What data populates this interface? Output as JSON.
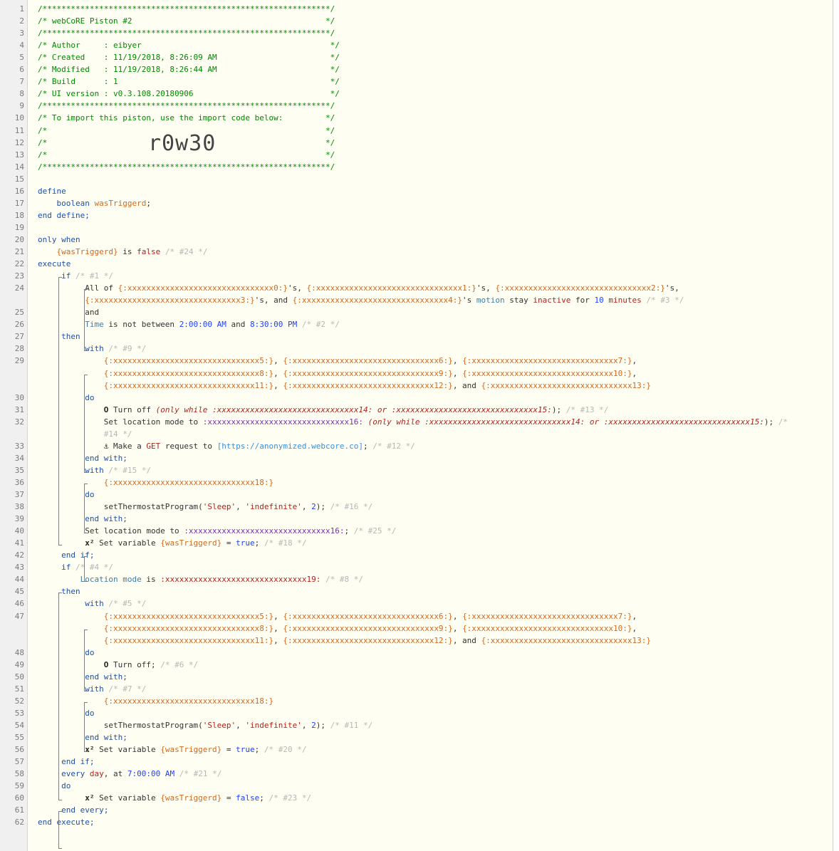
{
  "import_code": "r0w30",
  "lines": [
    {
      "n": "1",
      "parts": [
        {
          "t": "/*************************************************************/",
          "c": "c"
        }
      ]
    },
    {
      "n": "2",
      "parts": [
        {
          "t": "/* webCoRE Piston #2                                         */",
          "c": "c"
        }
      ]
    },
    {
      "n": "3",
      "parts": [
        {
          "t": "/*************************************************************/",
          "c": "c"
        }
      ]
    },
    {
      "n": "4",
      "parts": [
        {
          "t": "/* Author     : eibyer                                        */",
          "c": "c"
        }
      ]
    },
    {
      "n": "5",
      "parts": [
        {
          "t": "/* Created    : 11/19/2018, 8:26:09 AM                        */",
          "c": "c"
        }
      ]
    },
    {
      "n": "6",
      "parts": [
        {
          "t": "/* Modified   : 11/19/2018, 8:26:44 AM                        */",
          "c": "c"
        }
      ]
    },
    {
      "n": "7",
      "parts": [
        {
          "t": "/* Build      : 1                                             */",
          "c": "c"
        }
      ]
    },
    {
      "n": "8",
      "parts": [
        {
          "t": "/* UI version : v0.3.108.20180906                             */",
          "c": "c"
        }
      ]
    },
    {
      "n": "9",
      "parts": [
        {
          "t": "/*************************************************************/",
          "c": "c"
        }
      ]
    },
    {
      "n": "10",
      "parts": [
        {
          "t": "/* To import this piston, use the import code below:         */",
          "c": "c"
        }
      ]
    },
    {
      "n": "11",
      "parts": [
        {
          "t": "/*                                                           */",
          "c": "c"
        }
      ]
    },
    {
      "n": "12",
      "parts": [
        {
          "t": "/*                                                           */",
          "c": "c"
        }
      ]
    },
    {
      "n": "13",
      "parts": [
        {
          "t": "/*                                                           */",
          "c": "c"
        }
      ]
    },
    {
      "n": "14",
      "parts": [
        {
          "t": "/*************************************************************/",
          "c": "c"
        }
      ]
    },
    {
      "n": "15",
      "parts": []
    },
    {
      "n": "16",
      "parts": [
        {
          "t": "define",
          "c": "kw"
        }
      ]
    },
    {
      "n": "17",
      "parts": [
        {
          "t": "    boolean ",
          "c": "kw"
        },
        {
          "t": "wasTriggerd",
          "c": "var"
        },
        {
          "t": ";",
          "c": ""
        }
      ]
    },
    {
      "n": "18",
      "parts": [
        {
          "t": "end define;",
          "c": "kw"
        }
      ]
    },
    {
      "n": "19",
      "parts": []
    },
    {
      "n": "20",
      "parts": [
        {
          "t": "only when",
          "c": "kw"
        }
      ]
    },
    {
      "n": "21",
      "parts": [
        {
          "t": "    {wasTriggerd}",
          "c": "var"
        },
        {
          "t": " is ",
          "c": ""
        },
        {
          "t": "false",
          "c": "st"
        },
        {
          "t": " /* #24 */",
          "c": "cmt"
        }
      ]
    },
    {
      "n": "22",
      "parts": [
        {
          "t": "execute",
          "c": "kw"
        }
      ]
    },
    {
      "n": "23",
      "parts": [
        {
          "t": "     if",
          "c": "kw"
        },
        {
          "t": " /* #1 */",
          "c": "cmt"
        }
      ]
    },
    {
      "n": "24",
      "parts": [
        {
          "t": "          All of ",
          "c": ""
        },
        {
          "t": "{:xxxxxxxxxxxxxxxxxxxxxxxxxxxxxxx0:}",
          "c": "dev"
        },
        {
          "t": "'s, ",
          "c": ""
        },
        {
          "t": "{:xxxxxxxxxxxxxxxxxxxxxxxxxxxxxxx1:}",
          "c": "dev"
        },
        {
          "t": "'s, ",
          "c": ""
        },
        {
          "t": "{:xxxxxxxxxxxxxxxxxxxxxxxxxxxxxxx2:}",
          "c": "dev"
        },
        {
          "t": "'s,",
          "c": ""
        }
      ]
    },
    {
      "n": "",
      "parts": [
        {
          "t": "          {:xxxxxxxxxxxxxxxxxxxxxxxxxxxxxxx3:}",
          "c": "dev"
        },
        {
          "t": "'s, and ",
          "c": ""
        },
        {
          "t": "{:xxxxxxxxxxxxxxxxxxxxxxxxxxxxxxx4:}",
          "c": "dev"
        },
        {
          "t": "'s ",
          "c": ""
        },
        {
          "t": "motion",
          "c": "attr"
        },
        {
          "t": " stay ",
          "c": ""
        },
        {
          "t": "inactive",
          "c": "st"
        },
        {
          "t": " for ",
          "c": ""
        },
        {
          "t": "10",
          "c": "num"
        },
        {
          "t": " ",
          "c": ""
        },
        {
          "t": "minutes",
          "c": "st"
        },
        {
          "t": " /* #3 */",
          "c": "cmt"
        }
      ]
    },
    {
      "n": "25",
      "parts": [
        {
          "t": "          and",
          "c": ""
        }
      ]
    },
    {
      "n": "26",
      "parts": [
        {
          "t": "          Time",
          "c": "attr"
        },
        {
          "t": " is not between ",
          "c": ""
        },
        {
          "t": "2:00:00 AM",
          "c": "num"
        },
        {
          "t": " and ",
          "c": ""
        },
        {
          "t": "8:30:00 PM",
          "c": "num"
        },
        {
          "t": " /* #2 */",
          "c": "cmt"
        }
      ]
    },
    {
      "n": "27",
      "parts": [
        {
          "t": "     then",
          "c": "kw"
        }
      ]
    },
    {
      "n": "28",
      "parts": [
        {
          "t": "          with",
          "c": "kw"
        },
        {
          "t": " /* #9 */",
          "c": "cmt"
        }
      ]
    },
    {
      "n": "29",
      "parts": [
        {
          "t": "              {:xxxxxxxxxxxxxxxxxxxxxxxxxxxxxxx5:}",
          "c": "dev"
        },
        {
          "t": ", ",
          "c": ""
        },
        {
          "t": "{:xxxxxxxxxxxxxxxxxxxxxxxxxxxxxxx6:}",
          "c": "dev"
        },
        {
          "t": ", ",
          "c": ""
        },
        {
          "t": "{:xxxxxxxxxxxxxxxxxxxxxxxxxxxxxxx7:}",
          "c": "dev"
        },
        {
          "t": ",",
          "c": ""
        }
      ]
    },
    {
      "n": "",
      "parts": [
        {
          "t": "              {:xxxxxxxxxxxxxxxxxxxxxxxxxxxxxxx8:}",
          "c": "dev"
        },
        {
          "t": ", ",
          "c": ""
        },
        {
          "t": "{:xxxxxxxxxxxxxxxxxxxxxxxxxxxxxxx9:}",
          "c": "dev"
        },
        {
          "t": ", ",
          "c": ""
        },
        {
          "t": "{:xxxxxxxxxxxxxxxxxxxxxxxxxxxxxx10:}",
          "c": "dev"
        },
        {
          "t": ",",
          "c": ""
        }
      ]
    },
    {
      "n": "",
      "parts": [
        {
          "t": "              {:xxxxxxxxxxxxxxxxxxxxxxxxxxxxxx11:}",
          "c": "dev"
        },
        {
          "t": ", ",
          "c": ""
        },
        {
          "t": "{:xxxxxxxxxxxxxxxxxxxxxxxxxxxxxx12:}",
          "c": "dev"
        },
        {
          "t": ", and ",
          "c": ""
        },
        {
          "t": "{:xxxxxxxxxxxxxxxxxxxxxxxxxxxxxx13:}",
          "c": "dev"
        }
      ]
    },
    {
      "n": "30",
      "parts": [
        {
          "t": "          do",
          "c": "kw"
        }
      ]
    },
    {
      "n": "31",
      "parts": [
        {
          "t": "              ",
          "c": ""
        },
        {
          "t": "O",
          "c": "sym"
        },
        {
          "t": " Turn off ",
          "c": ""
        },
        {
          "t": "(only while ",
          "c": "cond"
        },
        {
          "t": ":xxxxxxxxxxxxxxxxxxxxxxxxxxxxxx14:",
          "c": "cond"
        },
        {
          "t": " or ",
          "c": "cond"
        },
        {
          "t": ":xxxxxxxxxxxxxxxxxxxxxxxxxxxxxx15:",
          "c": "cond"
        },
        {
          "t": ");",
          "c": ""
        },
        {
          "t": " /* #13 */",
          "c": "cmt"
        }
      ]
    },
    {
      "n": "32",
      "parts": [
        {
          "t": "              Set location mode to ",
          "c": ""
        },
        {
          "t": ":xxxxxxxxxxxxxxxxxxxxxxxxxxxxxx16:",
          "c": "vv"
        },
        {
          "t": " (only while ",
          "c": "cond"
        },
        {
          "t": ":xxxxxxxxxxxxxxxxxxxxxxxxxxxxxx14:",
          "c": "cond"
        },
        {
          "t": " or ",
          "c": "cond"
        },
        {
          "t": ":xxxxxxxxxxxxxxxxxxxxxxxxxxxxxx15:",
          "c": "cond"
        },
        {
          "t": ");",
          "c": ""
        },
        {
          "t": " /*",
          "c": "cmt"
        }
      ]
    },
    {
      "n": "",
      "parts": [
        {
          "t": "              #14 */",
          "c": "cmt"
        }
      ]
    },
    {
      "n": "33",
      "parts": [
        {
          "t": "              ",
          "c": ""
        },
        {
          "t": "⚓",
          "c": "sym"
        },
        {
          "t": " Make a ",
          "c": ""
        },
        {
          "t": "GET",
          "c": "st"
        },
        {
          "t": " request to ",
          "c": ""
        },
        {
          "t": "[https://anonymized.webcore.co]",
          "c": "url"
        },
        {
          "t": ";",
          "c": ""
        },
        {
          "t": " /* #12 */",
          "c": "cmt"
        }
      ]
    },
    {
      "n": "34",
      "parts": [
        {
          "t": "          end with;",
          "c": "kw"
        }
      ]
    },
    {
      "n": "35",
      "parts": [
        {
          "t": "          with",
          "c": "kw"
        },
        {
          "t": " /* #15 */",
          "c": "cmt"
        }
      ]
    },
    {
      "n": "36",
      "parts": [
        {
          "t": "              {:xxxxxxxxxxxxxxxxxxxxxxxxxxxxxx18:}",
          "c": "dev"
        }
      ]
    },
    {
      "n": "37",
      "parts": [
        {
          "t": "          do",
          "c": "kw"
        }
      ]
    },
    {
      "n": "38",
      "parts": [
        {
          "t": "              setThermostatProgram(",
          "c": ""
        },
        {
          "t": "'Sleep'",
          "c": "str"
        },
        {
          "t": ", ",
          "c": ""
        },
        {
          "t": "'indefinite'",
          "c": "str"
        },
        {
          "t": ", ",
          "c": ""
        },
        {
          "t": "2",
          "c": "num"
        },
        {
          "t": ");",
          "c": ""
        },
        {
          "t": " /* #16 */",
          "c": "cmt"
        }
      ]
    },
    {
      "n": "39",
      "parts": [
        {
          "t": "          end with;",
          "c": "kw"
        }
      ]
    },
    {
      "n": "40",
      "parts": [
        {
          "t": "          Set location mode to ",
          "c": ""
        },
        {
          "t": ":xxxxxxxxxxxxxxxxxxxxxxxxxxxxxx16:",
          "c": "vv"
        },
        {
          "t": ";",
          "c": ""
        },
        {
          "t": " /* #25 */",
          "c": "cmt"
        }
      ]
    },
    {
      "n": "41",
      "parts": [
        {
          "t": "          ",
          "c": ""
        },
        {
          "t": "x²",
          "c": "sym"
        },
        {
          "t": " Set variable ",
          "c": ""
        },
        {
          "t": "{wasTriggerd}",
          "c": "var"
        },
        {
          "t": " = ",
          "c": ""
        },
        {
          "t": "true",
          "c": "num"
        },
        {
          "t": ";",
          "c": ""
        },
        {
          "t": " /* #18 */",
          "c": "cmt"
        }
      ]
    },
    {
      "n": "42",
      "parts": [
        {
          "t": "     end if;",
          "c": "kw"
        }
      ]
    },
    {
      "n": "43",
      "parts": [
        {
          "t": "     if",
          "c": "kw"
        },
        {
          "t": " /* #4 */",
          "c": "cmt"
        }
      ]
    },
    {
      "n": "44",
      "parts": [
        {
          "t": "         ",
          "c": ""
        },
        {
          "t": "Location mode",
          "c": "attr"
        },
        {
          "t": " is ",
          "c": ""
        },
        {
          "t": ":xxxxxxxxxxxxxxxxxxxxxxxxxxxxxx19:",
          "c": "st"
        },
        {
          "t": " /* #8 */",
          "c": "cmt"
        }
      ]
    },
    {
      "n": "45",
      "parts": [
        {
          "t": "     then",
          "c": "kw"
        }
      ]
    },
    {
      "n": "46",
      "parts": [
        {
          "t": "          with",
          "c": "kw"
        },
        {
          "t": " /* #5 */",
          "c": "cmt"
        }
      ]
    },
    {
      "n": "47",
      "parts": [
        {
          "t": "              {:xxxxxxxxxxxxxxxxxxxxxxxxxxxxxxx5:}",
          "c": "dev"
        },
        {
          "t": ", ",
          "c": ""
        },
        {
          "t": "{:xxxxxxxxxxxxxxxxxxxxxxxxxxxxxxx6:}",
          "c": "dev"
        },
        {
          "t": ", ",
          "c": ""
        },
        {
          "t": "{:xxxxxxxxxxxxxxxxxxxxxxxxxxxxxxx7:}",
          "c": "dev"
        },
        {
          "t": ",",
          "c": ""
        }
      ]
    },
    {
      "n": "",
      "parts": [
        {
          "t": "              {:xxxxxxxxxxxxxxxxxxxxxxxxxxxxxxx8:}",
          "c": "dev"
        },
        {
          "t": ", ",
          "c": ""
        },
        {
          "t": "{:xxxxxxxxxxxxxxxxxxxxxxxxxxxxxxx9:}",
          "c": "dev"
        },
        {
          "t": ", ",
          "c": ""
        },
        {
          "t": "{:xxxxxxxxxxxxxxxxxxxxxxxxxxxxxx10:}",
          "c": "dev"
        },
        {
          "t": ",",
          "c": ""
        }
      ]
    },
    {
      "n": "",
      "parts": [
        {
          "t": "              {:xxxxxxxxxxxxxxxxxxxxxxxxxxxxxx11:}",
          "c": "dev"
        },
        {
          "t": ", ",
          "c": ""
        },
        {
          "t": "{:xxxxxxxxxxxxxxxxxxxxxxxxxxxxxx12:}",
          "c": "dev"
        },
        {
          "t": ", and ",
          "c": ""
        },
        {
          "t": "{:xxxxxxxxxxxxxxxxxxxxxxxxxxxxxx13:}",
          "c": "dev"
        }
      ]
    },
    {
      "n": "48",
      "parts": [
        {
          "t": "          do",
          "c": "kw"
        }
      ]
    },
    {
      "n": "49",
      "parts": [
        {
          "t": "              ",
          "c": ""
        },
        {
          "t": "O",
          "c": "sym"
        },
        {
          "t": " Turn off;",
          "c": ""
        },
        {
          "t": " /* #6 */",
          "c": "cmt"
        }
      ]
    },
    {
      "n": "50",
      "parts": [
        {
          "t": "          end with;",
          "c": "kw"
        }
      ]
    },
    {
      "n": "51",
      "parts": [
        {
          "t": "          with",
          "c": "kw"
        },
        {
          "t": " /* #7 */",
          "c": "cmt"
        }
      ]
    },
    {
      "n": "52",
      "parts": [
        {
          "t": "              {:xxxxxxxxxxxxxxxxxxxxxxxxxxxxxx18:}",
          "c": "dev"
        }
      ]
    },
    {
      "n": "53",
      "parts": [
        {
          "t": "          do",
          "c": "kw"
        }
      ]
    },
    {
      "n": "54",
      "parts": [
        {
          "t": "              setThermostatProgram(",
          "c": ""
        },
        {
          "t": "'Sleep'",
          "c": "str"
        },
        {
          "t": ", ",
          "c": ""
        },
        {
          "t": "'indefinite'",
          "c": "str"
        },
        {
          "t": ", ",
          "c": ""
        },
        {
          "t": "2",
          "c": "num"
        },
        {
          "t": ");",
          "c": ""
        },
        {
          "t": " /* #11 */",
          "c": "cmt"
        }
      ]
    },
    {
      "n": "55",
      "parts": [
        {
          "t": "          end with;",
          "c": "kw"
        }
      ]
    },
    {
      "n": "56",
      "parts": [
        {
          "t": "          ",
          "c": ""
        },
        {
          "t": "x²",
          "c": "sym"
        },
        {
          "t": " Set variable ",
          "c": ""
        },
        {
          "t": "{wasTriggerd}",
          "c": "var"
        },
        {
          "t": " = ",
          "c": ""
        },
        {
          "t": "true",
          "c": "num"
        },
        {
          "t": ";",
          "c": ""
        },
        {
          "t": " /* #20 */",
          "c": "cmt"
        }
      ]
    },
    {
      "n": "57",
      "parts": [
        {
          "t": "     end if;",
          "c": "kw"
        }
      ]
    },
    {
      "n": "58",
      "parts": [
        {
          "t": "     every ",
          "c": "kw"
        },
        {
          "t": "day",
          "c": "st"
        },
        {
          "t": ", at ",
          "c": ""
        },
        {
          "t": "7:00:00 AM",
          "c": "num"
        },
        {
          "t": " /* #21 */",
          "c": "cmt"
        }
      ]
    },
    {
      "n": "59",
      "parts": [
        {
          "t": "     do",
          "c": "kw"
        }
      ]
    },
    {
      "n": "60",
      "parts": [
        {
          "t": "          ",
          "c": ""
        },
        {
          "t": "x²",
          "c": "sym"
        },
        {
          "t": " Set variable ",
          "c": ""
        },
        {
          "t": "{wasTriggerd}",
          "c": "var"
        },
        {
          "t": " = ",
          "c": ""
        },
        {
          "t": "false",
          "c": "num"
        },
        {
          "t": ";",
          "c": ""
        },
        {
          "t": " /* #23 */",
          "c": "cmt"
        }
      ]
    },
    {
      "n": "61",
      "parts": [
        {
          "t": "     end every;",
          "c": "kw"
        }
      ]
    },
    {
      "n": "62",
      "parts": [
        {
          "t": "end execute;",
          "c": "kw"
        }
      ]
    }
  ]
}
